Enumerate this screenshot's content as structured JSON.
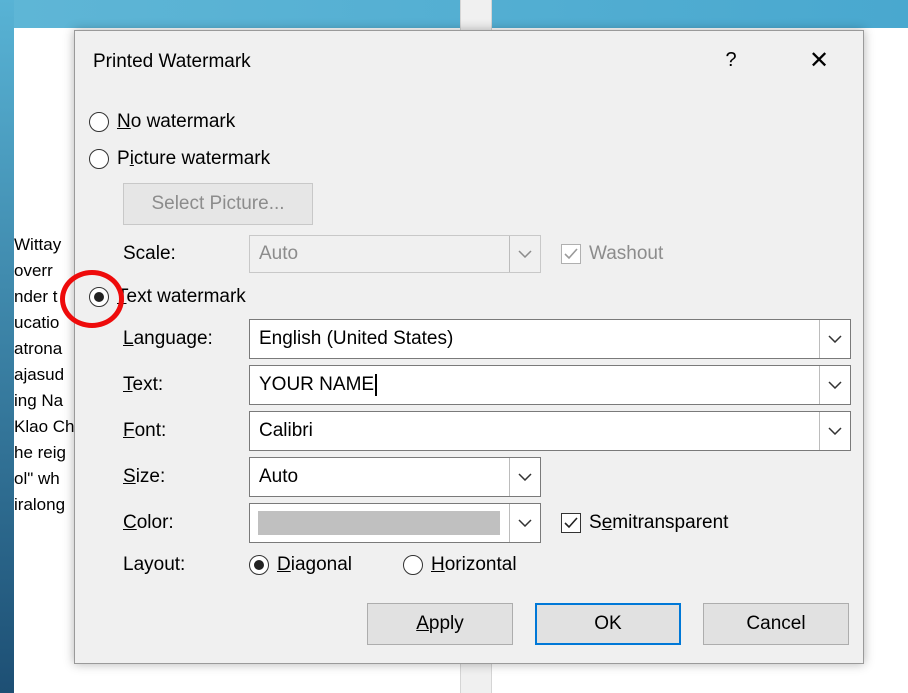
{
  "document": {
    "lines": [
      "Wittay",
      "overr",
      "nder t",
      "ucatio",
      "atrona",
      "ajasud",
      "ing Na",
      "Klao Ch",
      "he reig",
      "ol\" wh",
      "iralong"
    ]
  },
  "dialog": {
    "title": "Printed Watermark",
    "help_label": "?",
    "close_label": "✕",
    "no_watermark": {
      "hot": "N",
      "rest": "o watermark"
    },
    "picture_watermark": {
      "pre": "P",
      "hot": "i",
      "rest": "cture watermark"
    },
    "select_picture_label": "Select Picture...",
    "scale_label": "Scale:",
    "scale_value": "Auto",
    "washout_label": "Washout",
    "text_watermark": {
      "hot": "T",
      "rest": "ext watermark"
    },
    "language": {
      "hot": "L",
      "rest": "anguage:",
      "value": "English (United States)"
    },
    "text": {
      "hot": "T",
      "rest": "ext:",
      "value": "YOUR NAME"
    },
    "font": {
      "hot": "F",
      "rest": "ont:",
      "value": "Calibri"
    },
    "size": {
      "hot": "S",
      "rest": "ize:",
      "value": "Auto"
    },
    "color": {
      "hot": "C",
      "rest": "olor:",
      "value_hex": "#c0c0c0"
    },
    "semitransparent": {
      "pre": "S",
      "hot": "e",
      "rest": "mitransparent"
    },
    "layout_label": "Layout:",
    "diagonal": {
      "hot": "D",
      "rest": "iagonal"
    },
    "horizontal": {
      "hot": "H",
      "rest": "orizontal"
    },
    "apply": {
      "hot": "A",
      "rest": "pply"
    },
    "ok_label": "OK",
    "cancel_label": "Cancel",
    "selected_watermark": "text",
    "selected_layout": "diagonal",
    "semitransparent_checked": true,
    "washout_checked": true
  },
  "colors": {
    "annotation_red": "#ee0b0b",
    "default_button_border": "#0078d7"
  }
}
